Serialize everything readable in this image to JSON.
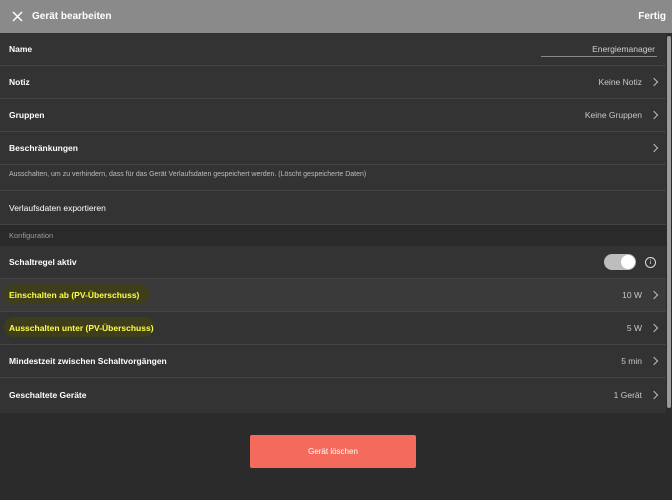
{
  "header": {
    "title": "Gerät bearbeiten",
    "done_label": "Fertig",
    "close_icon": "close-icon"
  },
  "rows": {
    "name": {
      "label": "Name",
      "value": "Energiemanager"
    },
    "notiz": {
      "label": "Notiz",
      "value": "Keine Notiz"
    },
    "gruppen": {
      "label": "Gruppen",
      "value": "Keine Gruppen"
    },
    "beschraenkungen": {
      "label": "Beschränkungen"
    },
    "description": "Ausschalten, um zu verhindern, dass für das Gerät Verlaufsdaten gespeichert werden. (Löscht gespeicherte Daten)",
    "export": {
      "label": "Verlaufsdaten exportieren"
    }
  },
  "section": {
    "title": "Konfiguration"
  },
  "config": {
    "schaltregel": {
      "label": "Schaltregel aktiv",
      "enabled": true
    },
    "einschalten": {
      "label": "Einschalten ab (PV-Überschuss)",
      "value": "10 W"
    },
    "ausschalten": {
      "label": "Ausschalten unter (PV-Überschuss)",
      "value": "5 W"
    },
    "mindestzeit": {
      "label": "Mindestzeit zwischen Schaltvorgängen",
      "value": "5 min"
    },
    "geschaltete": {
      "label": "Geschaltete Geräte",
      "value": "1 Gerät"
    }
  },
  "footer": {
    "delete_label": "Gerät löschen"
  },
  "colors": {
    "header_bg": "#8a8a8a",
    "content_bg": "#333333",
    "highlight_text": "#ffff4a",
    "delete_bg": "#f46b5e"
  }
}
